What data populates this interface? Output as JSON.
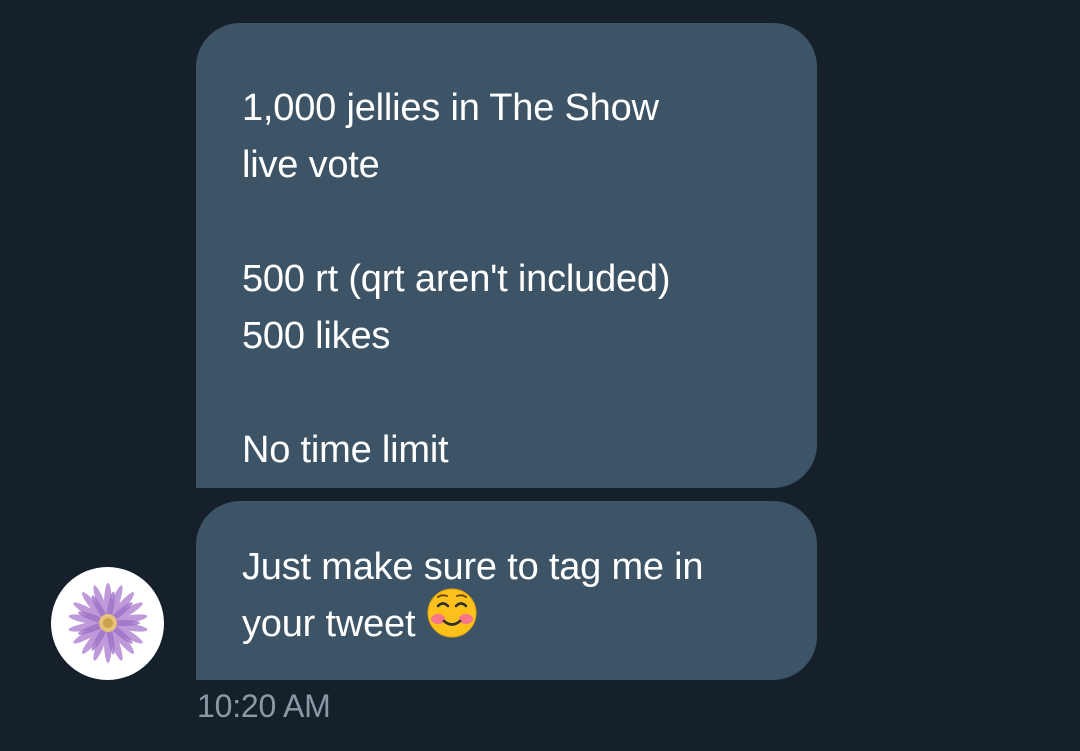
{
  "conversation": {
    "messages": [
      {
        "lines": [
          "1,000 jellies in The Show",
          "live vote",
          "",
          "500 rt (qrt aren't included)",
          "500 likes",
          "",
          "No time limit"
        ]
      },
      {
        "lines": [
          "Just make sure to tag me in",
          "your tweet"
        ],
        "trailing_icon": "smiling-blushing-emoji-icon"
      }
    ],
    "sender_avatar": "flower-avatar",
    "timestamp": "10:20 AM"
  },
  "colors": {
    "background": "#15202b",
    "bubble": "#3d5466",
    "text": "#ffffff",
    "timestamp": "#8b98a5"
  }
}
